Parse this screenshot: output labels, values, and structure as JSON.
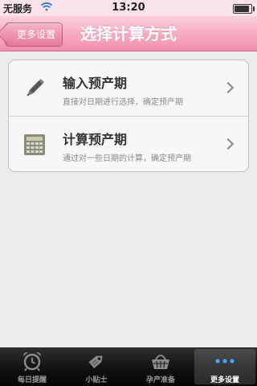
{
  "status_bar": {
    "carrier": "无服务",
    "time": "13:20",
    "battery_level": 0.9
  },
  "nav": {
    "back_label": "更多设置",
    "title": "选择计算方式"
  },
  "options": [
    {
      "icon": "pencil-icon",
      "title": "输入预产期",
      "subtitle": "直接对日期进行选择，确定预产期"
    },
    {
      "icon": "calculator-icon",
      "title": "计算预产期",
      "subtitle": "通过对一些日期的计算，确定预产期"
    }
  ],
  "tabs": [
    {
      "icon": "alarm-clock-icon",
      "label": "每日提醒",
      "active": false
    },
    {
      "icon": "tag-icon",
      "label": "小贴士",
      "active": false
    },
    {
      "icon": "basket-icon",
      "label": "孕产准备",
      "active": false
    },
    {
      "icon": "more-dots-icon",
      "label": "更多设置",
      "active": true
    }
  ],
  "colors": {
    "nav_pink": "#f6a7bd",
    "active_dot_blue": "#4aa3ff"
  }
}
